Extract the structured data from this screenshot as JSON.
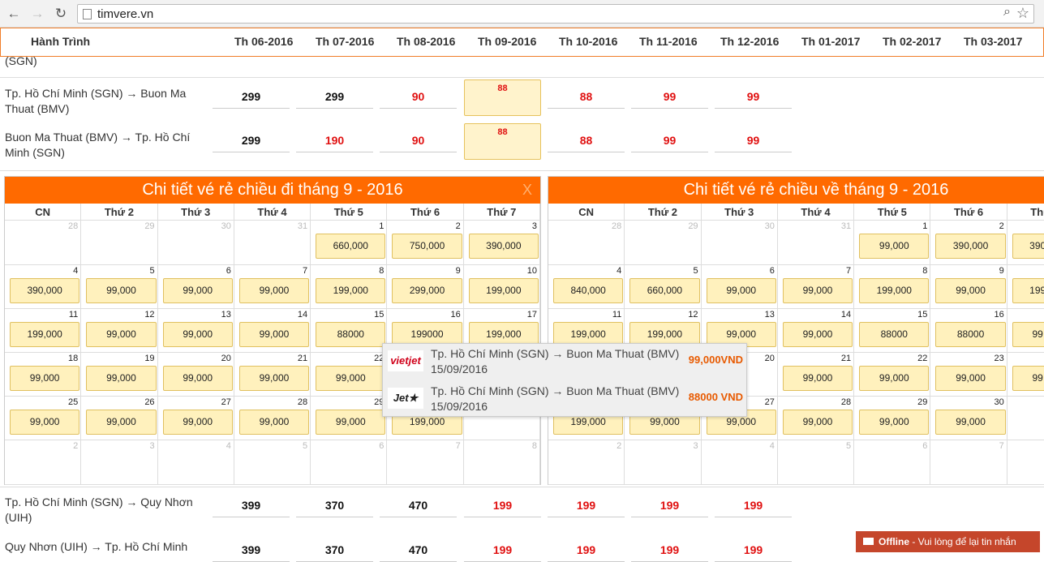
{
  "browser": {
    "url": "timvere.vn"
  },
  "header": {
    "route_label": "Hành Trình",
    "months": [
      "Th 06-2016",
      "Th 07-2016",
      "Th 08-2016",
      "Th 09-2016",
      "Th 10-2016",
      "Th 11-2016",
      "Th 12-2016",
      "Th 01-2017",
      "Th 02-2017",
      "Th 03-2017"
    ]
  },
  "partial_top_label": "(SGN)",
  "routes_top": [
    {
      "label": "Tp. Hồ Chí Minh (SGN) → Buon Ma Thuat (BMV)",
      "prices": [
        "299",
        "299",
        "90",
        "88",
        "88",
        "99",
        "99"
      ],
      "red": [
        false,
        false,
        true,
        true,
        true,
        true,
        true
      ]
    },
    {
      "label": "Buon Ma Thuat (BMV) → Tp. Hồ Chí Minh (SGN)",
      "prices": [
        "299",
        "190",
        "90",
        "88",
        "88",
        "99",
        "99"
      ],
      "red": [
        false,
        true,
        true,
        true,
        true,
        true,
        true
      ]
    }
  ],
  "routes_bottom": [
    {
      "label": "Tp. Hồ Chí Minh (SGN) → Quy Nhơn (UIH)",
      "prices": [
        "399",
        "370",
        "470",
        "199",
        "199",
        "199",
        "199"
      ],
      "red": [
        false,
        false,
        false,
        true,
        true,
        true,
        true
      ]
    },
    {
      "label": "Quy Nhơn (UIH) → Tp. Hồ Chí Minh",
      "prices": [
        "399",
        "370",
        "470",
        "199",
        "199",
        "199",
        "199"
      ],
      "red": [
        false,
        false,
        false,
        true,
        true,
        true,
        true
      ]
    }
  ],
  "selected_month_index": 3,
  "weekdays": [
    "CN",
    "Thứ 2",
    "Thứ 3",
    "Thứ 4",
    "Thứ 5",
    "Thứ 6",
    "Thứ 7"
  ],
  "calendars": [
    {
      "title": "Chi tiết vé rẻ chiều đi tháng 9 - 2016",
      "close": "X",
      "days": [
        [
          "28",
          "",
          1
        ],
        [
          "29",
          "",
          1
        ],
        [
          "30",
          "",
          1
        ],
        [
          "31",
          "",
          1
        ],
        [
          "1",
          "660,000",
          0
        ],
        [
          "2",
          "750,000",
          0
        ],
        [
          "3",
          "390,000",
          0
        ],
        [
          "4",
          "390,000",
          0
        ],
        [
          "5",
          "99,000",
          0
        ],
        [
          "6",
          "99,000",
          0
        ],
        [
          "7",
          "99,000",
          0
        ],
        [
          "8",
          "199,000",
          0
        ],
        [
          "9",
          "299,000",
          0
        ],
        [
          "10",
          "199,000",
          0
        ],
        [
          "11",
          "199,000",
          0
        ],
        [
          "12",
          "99,000",
          0
        ],
        [
          "13",
          "99,000",
          0
        ],
        [
          "14",
          "99,000",
          0
        ],
        [
          "15",
          "88000",
          0
        ],
        [
          "16",
          "199000",
          0
        ],
        [
          "17",
          "199,000",
          0
        ],
        [
          "18",
          "99,000",
          0
        ],
        [
          "19",
          "99,000",
          0
        ],
        [
          "20",
          "99,000",
          0
        ],
        [
          "21",
          "99,000",
          0
        ],
        [
          "22",
          "99,000",
          0
        ],
        [
          "23",
          "",
          0
        ],
        [
          "24",
          "",
          0
        ],
        [
          "25",
          "99,000",
          0
        ],
        [
          "26",
          "99,000",
          0
        ],
        [
          "27",
          "99,000",
          0
        ],
        [
          "28",
          "99,000",
          0
        ],
        [
          "29",
          "99,000",
          0
        ],
        [
          "30",
          "199,000",
          0
        ],
        [
          "1",
          "",
          1
        ],
        [
          "2",
          "",
          1
        ],
        [
          "3",
          "",
          1
        ],
        [
          "4",
          "",
          1
        ],
        [
          "5",
          "",
          1
        ],
        [
          "6",
          "",
          1
        ],
        [
          "7",
          "",
          1
        ],
        [
          "8",
          "",
          1
        ]
      ]
    },
    {
      "title": "Chi tiết vé rẻ chiều về tháng 9 - 2016",
      "close": "X",
      "days": [
        [
          "28",
          "",
          1
        ],
        [
          "29",
          "",
          1
        ],
        [
          "30",
          "",
          1
        ],
        [
          "31",
          "",
          1
        ],
        [
          "1",
          "99,000",
          0
        ],
        [
          "2",
          "390,000",
          0
        ],
        [
          "3",
          "390,000",
          0
        ],
        [
          "4",
          "840,000",
          0
        ],
        [
          "5",
          "660,000",
          0
        ],
        [
          "6",
          "99,000",
          0
        ],
        [
          "7",
          "99,000",
          0
        ],
        [
          "8",
          "199,000",
          0
        ],
        [
          "9",
          "99,000",
          0
        ],
        [
          "10",
          "199,000",
          0
        ],
        [
          "11",
          "199,000",
          0
        ],
        [
          "12",
          "199,000",
          0
        ],
        [
          "13",
          "99,000",
          0
        ],
        [
          "14",
          "99,000",
          0
        ],
        [
          "15",
          "88000",
          0
        ],
        [
          "16",
          "88000",
          0
        ],
        [
          "17",
          "99,000",
          0
        ],
        [
          "18",
          "",
          0
        ],
        [
          "19",
          "",
          0
        ],
        [
          "20",
          "",
          0
        ],
        [
          "21",
          "99,000",
          0
        ],
        [
          "22",
          "99,000",
          0
        ],
        [
          "23",
          "99,000",
          0
        ],
        [
          "24",
          "99,000",
          0
        ],
        [
          "25",
          "199,000",
          0
        ],
        [
          "26",
          "99,000",
          0
        ],
        [
          "27",
          "99,000",
          0
        ],
        [
          "28",
          "99,000",
          0
        ],
        [
          "29",
          "99,000",
          0
        ],
        [
          "30",
          "99,000",
          0
        ],
        [
          "1",
          "",
          1
        ],
        [
          "2",
          "",
          1
        ],
        [
          "3",
          "",
          1
        ],
        [
          "4",
          "",
          1
        ],
        [
          "5",
          "",
          1
        ],
        [
          "6",
          "",
          1
        ],
        [
          "7",
          "",
          1
        ],
        [
          "8",
          "",
          1
        ]
      ]
    }
  ],
  "tooltip": [
    {
      "airline": "vietjet",
      "route": "Tp. Hồ Chí Minh (SGN) → Buon Ma Thuat (BMV)",
      "date": "15/09/2016",
      "price": "99,000VND"
    },
    {
      "airline": "Jet★",
      "route": "Tp. Hồ Chí Minh (SGN) → Buon Ma Thuat (BMV)",
      "date": "15/09/2016",
      "price": "88000 VND"
    }
  ],
  "chat": {
    "status": "Offline",
    "message": " - Vui lòng để lại tin nhắn"
  },
  "colors": {
    "accent": "#ff6a00",
    "price_red": "#e01010",
    "highlight": "#fff3cc"
  }
}
